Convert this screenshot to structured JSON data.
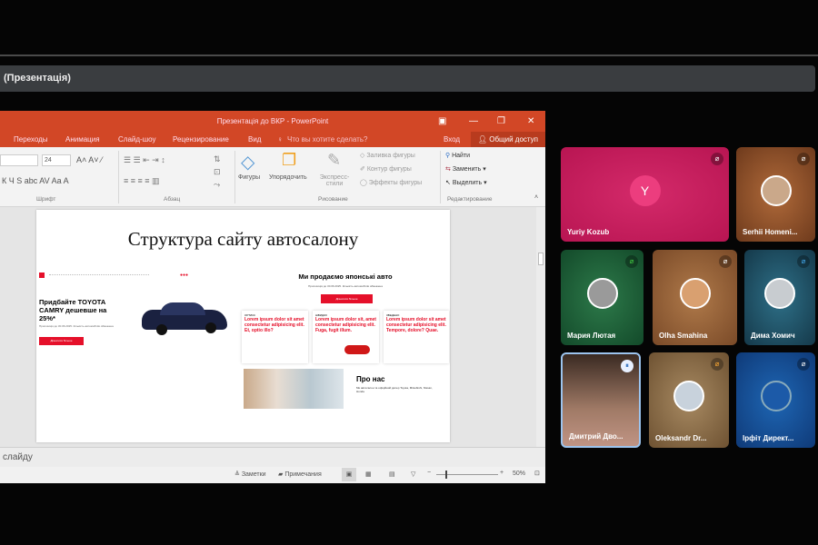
{
  "call": {
    "title": "(Презентація)"
  },
  "ppt": {
    "title": "Презентація до ВКР - PowerPoint",
    "tabs": [
      "Переходы",
      "Анимация",
      "Слайд-шоу",
      "Рецензирование",
      "Вид"
    ],
    "tell_me": "Что вы хотите сделать?",
    "signin": "Вход",
    "share": "Общий доступ",
    "font_size": "24",
    "groups": [
      "Шрифт",
      "Абзац",
      "Рисование",
      "Редактирование"
    ],
    "drawing": {
      "shapes": "Фигуры",
      "arrange": "Упорядочить",
      "quick_styles": "Экспресс-стили",
      "fill": "Заливка фигуры",
      "outline": "Контур фигуры",
      "effects": "Эффекты фигуры"
    },
    "editing": {
      "find": "Найти",
      "replace": "Заменить",
      "select": "Выделить"
    },
    "notes_placeholder": "слайду",
    "status": {
      "notes": "Заметки",
      "comments": "Примечания",
      "zoom": "50%"
    }
  },
  "slide": {
    "title": "Структура сайту автосалону",
    "hero_heading": "Придбайте TOYOTA CAMRY дешевше на 25%*",
    "hero_sub": "Пропозиція до 30.06.2025. Кількість автомобілів обмежена",
    "hero_button": "Дізнатися більше",
    "right_heading": "Ми продаємо японські авто",
    "right_sub": "Пропозиція до 30.06.2025. Кількість автомобілів обмежена",
    "right_button": "Дізнатися більше",
    "cards": [
      {
        "label": "ОРТИКС",
        "text": "Lorem ipsum dolor sit amet consectetur adipisicing elit. Et, optio illo?"
      },
      {
        "label": "ШВИДКО",
        "text": "Lorem ipsum dolor sit, amet consectetur adipisicing elit. Fuga, fugit illum."
      },
      {
        "label": "ЗВЕДЕНО",
        "text": "Lorem ipsum dolor sit amet consectetur adipisicing elit. Tempore, dolore? Quae."
      }
    ],
    "about_heading": "Про нас",
    "about_text": "Ми автосалон та офіційний дилер Toyota, Mitsubishi, Nissan, Honda"
  },
  "participants": [
    {
      "name": "Yuriy Kozub",
      "initial": "Y",
      "color": "#c8175a"
    },
    {
      "name": "Serhii Homeni...",
      "color": "#8a4a26"
    },
    {
      "name": "Мария Лютая",
      "color": "#1d5a36"
    },
    {
      "name": "Olha Smahina",
      "color": "#8f5a32"
    },
    {
      "name": "Дима Хомич",
      "color": "#1f5468"
    },
    {
      "name": "Дмитрий Дво...",
      "color": "#6a4a3c"
    },
    {
      "name": "Oleksandr Dr...",
      "color": "#7a5c3a"
    },
    {
      "name": "Ірфіт Директ...",
      "color": "#154a8a"
    }
  ]
}
